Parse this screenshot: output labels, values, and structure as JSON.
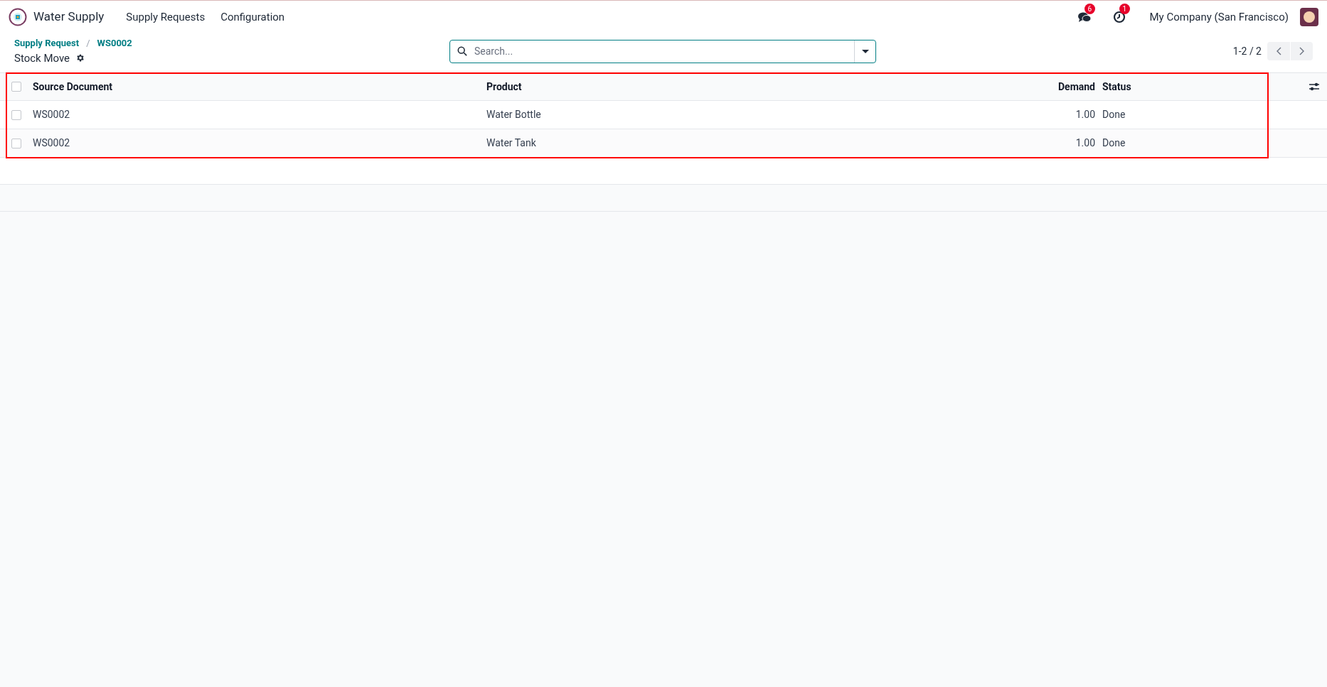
{
  "navbar": {
    "app_name": "Water Supply",
    "menu": [
      "Supply Requests",
      "Configuration"
    ],
    "messages_badge": "6",
    "activities_badge": "1",
    "company": "My Company (San Francisco)"
  },
  "breadcrumb": {
    "items": [
      "Supply Request",
      "WS0002"
    ],
    "separator": "/",
    "title": "Stock Move"
  },
  "search": {
    "placeholder": "Search..."
  },
  "pager": {
    "range": "1-2 / 2"
  },
  "table": {
    "columns": [
      "Source Document",
      "Product",
      "Demand",
      "Status"
    ],
    "all_checked": false,
    "rows": [
      {
        "checked": false,
        "cells": [
          "WS0002",
          "Water Bottle",
          "1.00",
          "Done"
        ]
      },
      {
        "checked": false,
        "cells": [
          "WS0002",
          "Water Tank",
          "1.00",
          "Done"
        ]
      }
    ]
  }
}
